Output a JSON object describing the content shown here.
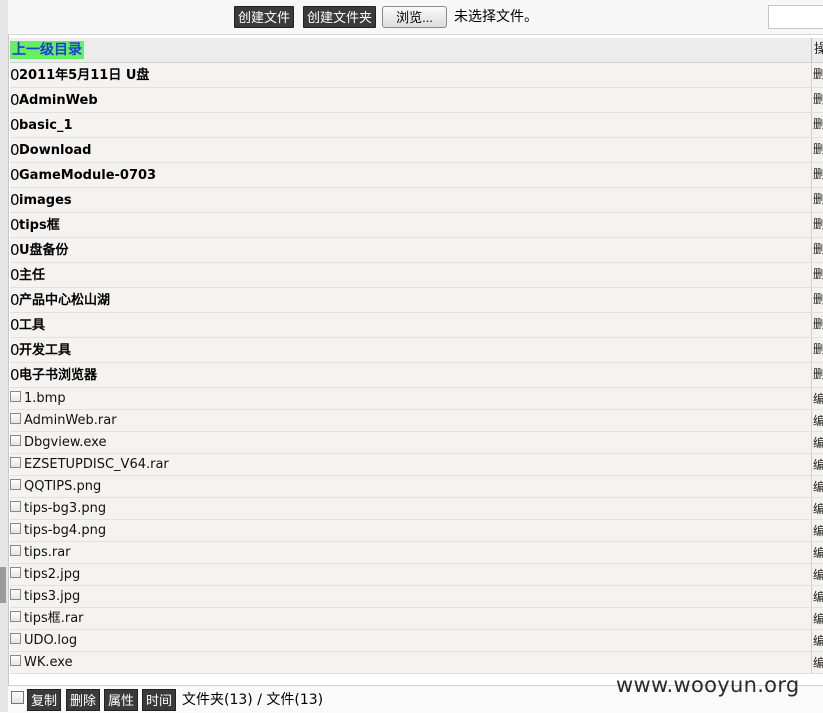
{
  "toolbar": {
    "create_file": "创建文件",
    "create_folder": "创建文件夹",
    "browse": "浏览...",
    "file_status": "未选择文件。"
  },
  "listing": {
    "parent_dir": "上一级目录",
    "header_action": "操",
    "folder_prefix": "0",
    "folder_action": "删",
    "file_action": "编",
    "folders": [
      "2011年5月11日 U盘",
      "AdminWeb",
      "basic_1",
      "Download",
      "GameModule-0703",
      "images",
      "tips框",
      "U盘备份",
      "主任",
      "产品中心松山湖",
      "工具",
      "开发工具",
      "电子书浏览器"
    ],
    "files": [
      "1.bmp",
      "AdminWeb.rar",
      "Dbgview.exe",
      "EZSETUPDISC_V64.rar",
      "QQTIPS.png",
      "tips-bg3.png",
      "tips-bg4.png",
      "tips.rar",
      "tips2.jpg",
      "tips3.jpg",
      "tips框.rar",
      "UDO.log",
      "WK.exe"
    ]
  },
  "bottom": {
    "copy": "复制",
    "delete": "删除",
    "properties": "属性",
    "time": "时间",
    "counts": "文件夹(13) / 文件(13)"
  },
  "watermark": "www.wooyun.org"
}
